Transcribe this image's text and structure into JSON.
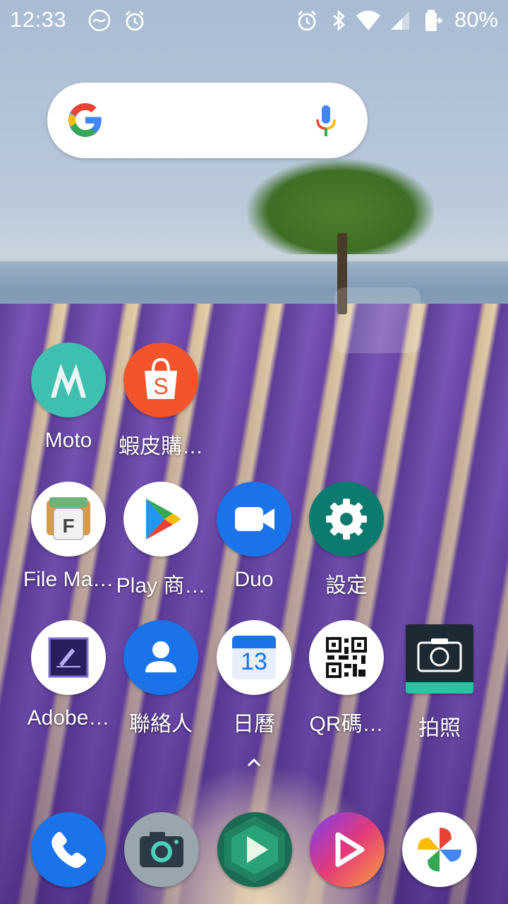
{
  "status_bar": {
    "time": "12:33",
    "battery": "80%",
    "icons": [
      "swirl-notification-icon",
      "alarm-icon",
      "alarm-icon",
      "bluetooth-icon",
      "wifi-icon",
      "cell-signal-icon",
      "battery-charging-icon"
    ]
  },
  "search": {
    "icons": [
      "google-logo-icon",
      "mic-icon"
    ]
  },
  "apps_row1": [
    {
      "label": "Moto",
      "icon": "moto-icon"
    },
    {
      "label": "蝦皮購…",
      "icon": "shopee-icon"
    }
  ],
  "apps_row2": [
    {
      "label": "File Ma…",
      "icon": "file-manager-icon"
    },
    {
      "label": "Play 商…",
      "icon": "play-store-icon"
    },
    {
      "label": "Duo",
      "icon": "duo-icon"
    },
    {
      "label": "設定",
      "icon": "settings-icon"
    }
  ],
  "apps_row3": [
    {
      "label": "Adobe…",
      "icon": "adobe-fill-sign-icon"
    },
    {
      "label": "聯絡人",
      "icon": "contacts-icon"
    },
    {
      "label": "日曆",
      "icon": "calendar-icon",
      "badge": "13"
    },
    {
      "label": "QR碼…",
      "icon": "qr-code-icon"
    },
    {
      "label": "拍照",
      "icon": "camera-icon"
    }
  ],
  "dock": [
    "phone-icon",
    "camera-app-icon",
    "play-video-icon",
    "video-player-icon",
    "photos-icon"
  ],
  "colors": {
    "moto_teal": "#3fbfb0",
    "shopee_orange": "#f3542c",
    "duo_blue": "#1a73e8",
    "settings_teal": "#0b7a6f",
    "contacts_blue": "#1a73e8",
    "camera_dark": "#1d2a33",
    "camera_teal": "#2bc4a2"
  }
}
